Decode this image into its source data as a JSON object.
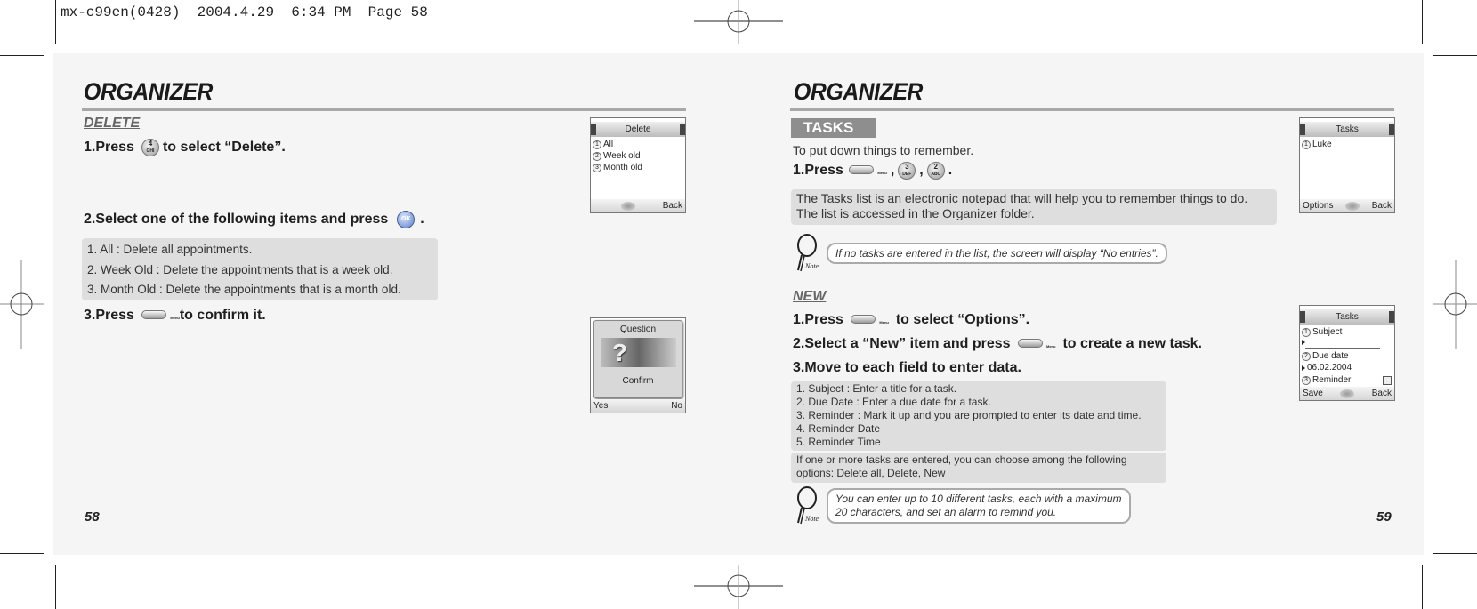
{
  "slug": "mx-c99en(0428)  2004.4.29  6:34 PM  Page 58",
  "left_page": {
    "title": "ORGANIZER",
    "section": "DELETE",
    "step1": {
      "prefix": "1.Press",
      "key": {
        "top": "4",
        "bottom": "GHI"
      },
      "suffix": "to select “Delete”."
    },
    "step2": {
      "prefix": "2.Select one of the following items and press",
      "key": "OK",
      "suffix": "."
    },
    "options": [
      "1. All : Delete all appointments.",
      "2. Week Old : Delete the appointments that is a week old.",
      "3. Month Old : Delete the appointments that is a month old."
    ],
    "step3": {
      "prefix": "3.Press",
      "key": "Menu",
      "suffix": "to confirm it."
    },
    "page_number": "58",
    "screen_delete": {
      "title": "Delete",
      "items": [
        {
          "num": "1",
          "label": "All"
        },
        {
          "num": "2",
          "label": "Week old"
        },
        {
          "num": "3",
          "label": "Month old"
        }
      ],
      "right_soft": "Back"
    },
    "screen_question": {
      "title": "Question",
      "icon": "?",
      "message": "Confirm",
      "left_soft": "Yes",
      "right_soft": "No"
    }
  },
  "right_page": {
    "title": "ORGANIZER",
    "section_tag": "TASKS",
    "intro": "To put down things to remember.",
    "step1": {
      "prefix": "1.Press",
      "key_menu": "Menu",
      "key2": {
        "top": "3",
        "bottom": "DEF"
      },
      "key3": {
        "top": "2",
        "bottom": "ABC"
      },
      "sep": ",",
      "suffix": "."
    },
    "description": [
      "The Tasks list is an electronic notepad that will help you to remember things to do.",
      "The list is accessed in the Organizer folder."
    ],
    "note1": {
      "label": "Note",
      "text": "If no tasks are entered in the list, the screen will display “No entries”."
    },
    "new_section": "NEW",
    "new_step1": {
      "prefix": "1.Press",
      "key": "Menu",
      "suffix": "to select “Options”."
    },
    "new_step2": {
      "prefix": "2.Select a “New” item and press",
      "key": "Menu",
      "suffix": "to create a new task."
    },
    "new_step3": "3.Move to each field to enter data.",
    "fields": [
      "1. Subject : Enter a title for a task.",
      "2. Due Date : Enter a due date for a task.",
      "3. Reminder : Mark it up and you are prompted to enter its date and time.",
      "4. Reminder Date",
      "5. Reminder Time"
    ],
    "options_info": [
      "If one or more tasks are entered, you can choose among the following",
      "options: Delete all, Delete, New"
    ],
    "note2": {
      "label": "Note",
      "lines": [
        "You can enter up to 10 different tasks, each with a maximum",
        "20 characters, and set an alarm to remind you."
      ]
    },
    "page_number": "59",
    "screen_tasks": {
      "title": "Tasks",
      "items": [
        {
          "num": "1",
          "label": "Luke"
        }
      ],
      "left_soft": "Options",
      "right_soft": "Back"
    },
    "screen_new_task": {
      "title": "Tasks",
      "field1": {
        "num": "1",
        "label": "Subject",
        "value": ""
      },
      "field2": {
        "num": "2",
        "label": "Due date",
        "value": "06.02.2004"
      },
      "field3": {
        "num": "3",
        "label": "Reminder",
        "checked": false
      },
      "left_soft": "Save",
      "right_soft": "Back"
    }
  }
}
